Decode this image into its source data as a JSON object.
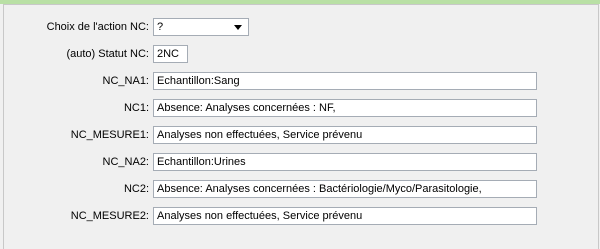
{
  "form": {
    "action": {
      "label": "Choix de l'action NC:",
      "value": "?"
    },
    "status": {
      "label": "(auto) Statut NC:",
      "value": "2NC"
    },
    "rows": [
      {
        "label": "NC_NA1:",
        "value": "Echantillon:Sang"
      },
      {
        "label": "NC1:",
        "value": "Absence:  Analyses concernées : NF,"
      },
      {
        "label": "NC_MESURE1:",
        "value": "Analyses non effectuées, Service prévenu"
      },
      {
        "label": "NC_NA2:",
        "value": "Echantillon:Urines"
      },
      {
        "label": "NC2:",
        "value": "Absence:  Analyses concernées : Bactériologie/Myco/Parasitologie,"
      },
      {
        "label": "NC_MESURE2:",
        "value": "Analyses non effectuées, Service prévenu"
      }
    ]
  }
}
